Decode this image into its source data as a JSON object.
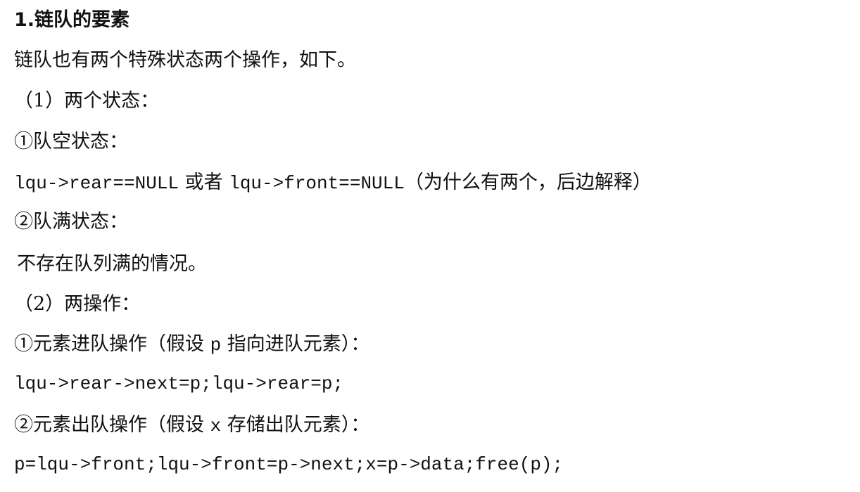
{
  "document": {
    "heading": "1.链队的要素",
    "intro": "链队也有两个特殊状态两个操作，如下。",
    "states_title": "（1）两个状态：",
    "empty_state_label": "①队空状态：",
    "empty_condition": {
      "code_a": "lqu->rear==NULL",
      "connector": " 或者 ",
      "code_b": "lqu->front==NULL",
      "note": "（为什么有两个，后边解释）"
    },
    "full_state_label": "②队满状态：",
    "full_state_desc": "不存在队列满的情况。",
    "ops_title": "（2）两操作：",
    "enqueue": {
      "label_pre": "①元素进队操作（假设 ",
      "label_var": "p",
      "label_post": " 指向进队元素）：",
      "code": "lqu->rear->next=p;lqu->rear=p;"
    },
    "dequeue": {
      "label_pre": "②元素出队操作（假设 ",
      "label_var": "x",
      "label_post": " 存储出队元素）：",
      "code": "p=lqu->front;lqu->front=p->next;x=p->data;free(p);"
    }
  }
}
